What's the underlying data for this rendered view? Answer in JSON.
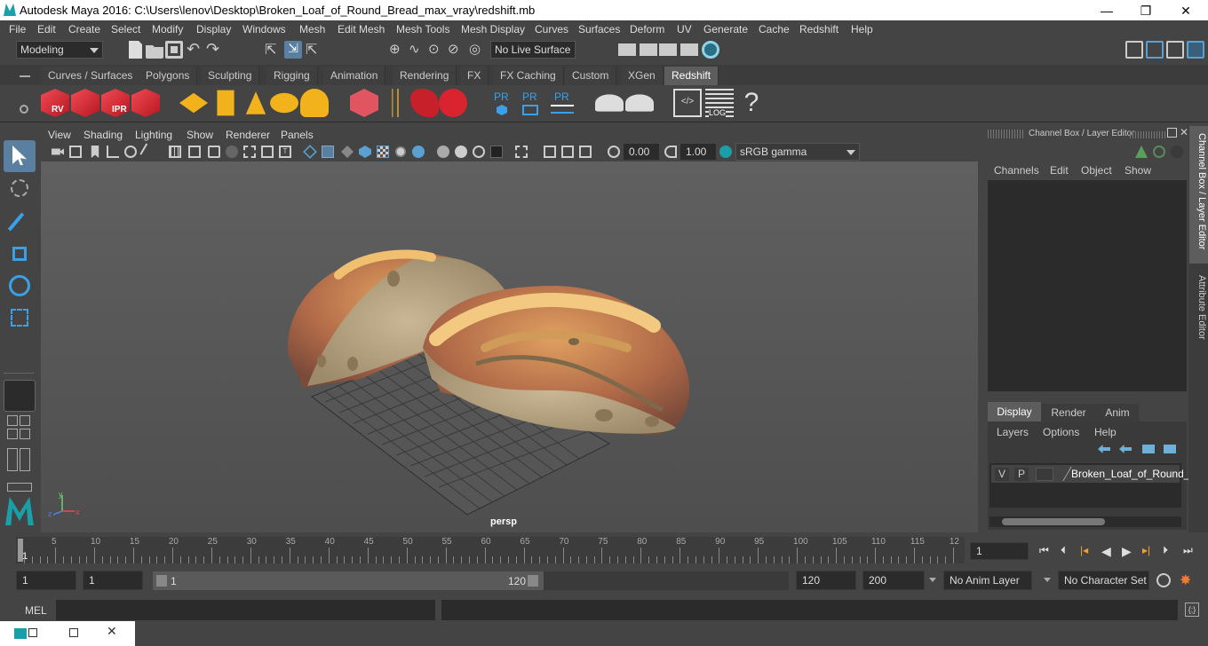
{
  "window": {
    "title": "Autodesk Maya 2016: C:\\Users\\lenov\\Desktop\\Broken_Loaf_of_Round_Bread_max_vray\\redshift.mb",
    "minimize": "—",
    "maximize": "❐",
    "close": "✕"
  },
  "menubar": [
    "File",
    "Edit",
    "Create",
    "Select",
    "Modify",
    "Display",
    "Windows",
    "Mesh",
    "Edit Mesh",
    "Mesh Tools",
    "Mesh Display",
    "Curves",
    "Surfaces",
    "Deform",
    "UV",
    "Generate",
    "Cache",
    "Redshift",
    "Help"
  ],
  "statusline": {
    "mode": "Modeling",
    "live_surface": "No Live Surface"
  },
  "shelf_tabs": [
    "Curves / Surfaces",
    "Polygons",
    "Sculpting",
    "Rigging",
    "Animation",
    "Rendering",
    "FX",
    "FX Caching",
    "Custom",
    "XGen",
    "Redshift"
  ],
  "shelf_active_tab": "Redshift",
  "shelf_labels": {
    "rv": "RV",
    "ipr": "IPR",
    "pr1": "PR",
    "pr2": "PR",
    "pr3": "PR",
    "log": "LOG",
    "help": "?"
  },
  "viewport": {
    "menu": [
      "View",
      "Shading",
      "Lighting",
      "Show",
      "Renderer",
      "Panels"
    ],
    "exposure": "0.00",
    "gamma": "1.00",
    "color_space": "sRGB gamma",
    "camera_label": "persp",
    "axis": {
      "y": "y",
      "x": "x",
      "z": "z"
    }
  },
  "channel_box": {
    "title": "Channel Box / Layer Editor",
    "menu": [
      "Channels",
      "Edit",
      "Object",
      "Show"
    ]
  },
  "layer_editor": {
    "tabs": [
      "Display",
      "Render",
      "Anim"
    ],
    "active_tab": "Display",
    "menu": [
      "Layers",
      "Options",
      "Help"
    ],
    "layers": [
      {
        "v": "V",
        "p": "P",
        "name": "Broken_Loaf_of_Round_"
      }
    ]
  },
  "side_tabs": [
    "Channel Box / Layer Editor",
    "Attribute Editor"
  ],
  "timeline": {
    "ticks": [
      "5",
      "10",
      "15",
      "20",
      "25",
      "30",
      "35",
      "40",
      "45",
      "50",
      "55",
      "60",
      "65",
      "70",
      "75",
      "80",
      "85",
      "90",
      "95",
      "100",
      "105",
      "110",
      "115",
      "12"
    ],
    "start_marker": "1",
    "current_frame": "1"
  },
  "range": {
    "start": "1",
    "playback_start": "1",
    "slider_start": "1",
    "slider_end": "120",
    "playback_end": "120",
    "end": "200",
    "anim_layer": "No Anim Layer",
    "char_set": "No Character Set"
  },
  "cmdline": {
    "label": "MEL"
  },
  "colors": {
    "accent": "#1a9fa8",
    "shelf_red": "#d9232f",
    "shelf_yellow": "#f2b21b",
    "shelf_blue": "#2f8fd6"
  }
}
